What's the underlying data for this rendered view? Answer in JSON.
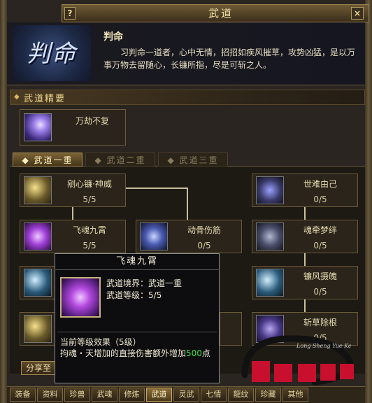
{
  "window": {
    "title": "武道",
    "help_label": "?",
    "close_label": "×"
  },
  "header": {
    "emblem_text": "判命",
    "name": "判命",
    "description": "习判命一道者，心中无情，招招如疾风摧草，攻势凶猛，是以万事万物去留随心，长镰所指，尽是可斩之人。"
  },
  "essence": {
    "bullet": "◆",
    "label": "武道精要",
    "skill_name": "万劫不复"
  },
  "tiers": [
    {
      "label": "◆ 武道一重",
      "active": true
    },
    {
      "label": "◆ 武道二重",
      "active": false
    },
    {
      "label": "◆ 武道三重",
      "active": false
    }
  ],
  "skills": [
    {
      "name": "剜心镰·神威",
      "level": "5/5",
      "icon": "scythe-glow-icon"
    },
    {
      "name": "世难由己",
      "level": "0/5",
      "icon": "swirl-icon"
    },
    {
      "name": "飞魂九霄",
      "level": "5/5",
      "icon": "purple-flame-icon"
    },
    {
      "name": "动骨伤筋",
      "level": "0/5",
      "icon": "spirit-burst-icon"
    },
    {
      "name": "魂牵梦绊",
      "level": "0/5",
      "icon": "chain-soul-icon"
    },
    {
      "name": "镰风摄魄",
      "level": "0/5",
      "icon": "wind-scythe-icon"
    },
    {
      "name": "斩草除根",
      "level": "0/5",
      "icon": "reap-icon"
    }
  ],
  "tooltip": {
    "title": "飞魂九霄",
    "realm": "武道境界：武道一重",
    "level": "武道等级：5/5",
    "effect_head": "当前等级效果（5级）",
    "effect_text_before": "拘魂・天增加的直接伤害额外增加",
    "effect_value": "500",
    "effect_text_after": "点"
  },
  "share_button": "分享至",
  "watermark": {
    "caption": "Long  Sheng  Yue  Ke"
  },
  "bottom_tabs": [
    {
      "label": "装备",
      "active": false
    },
    {
      "label": "资料",
      "active": false
    },
    {
      "label": "珍兽",
      "active": false
    },
    {
      "label": "武魂",
      "active": false
    },
    {
      "label": "修炼",
      "active": false
    },
    {
      "label": "武道",
      "active": true
    },
    {
      "label": "灵武",
      "active": false
    },
    {
      "label": "七情",
      "active": false
    },
    {
      "label": "龍纹",
      "active": false
    },
    {
      "label": "珍藏",
      "active": false
    },
    {
      "label": "其他",
      "active": false
    }
  ],
  "colors": {
    "accent_gold": "#f0d890",
    "value_green": "#3fe040",
    "tooltip_bg": "#0c0c10"
  }
}
